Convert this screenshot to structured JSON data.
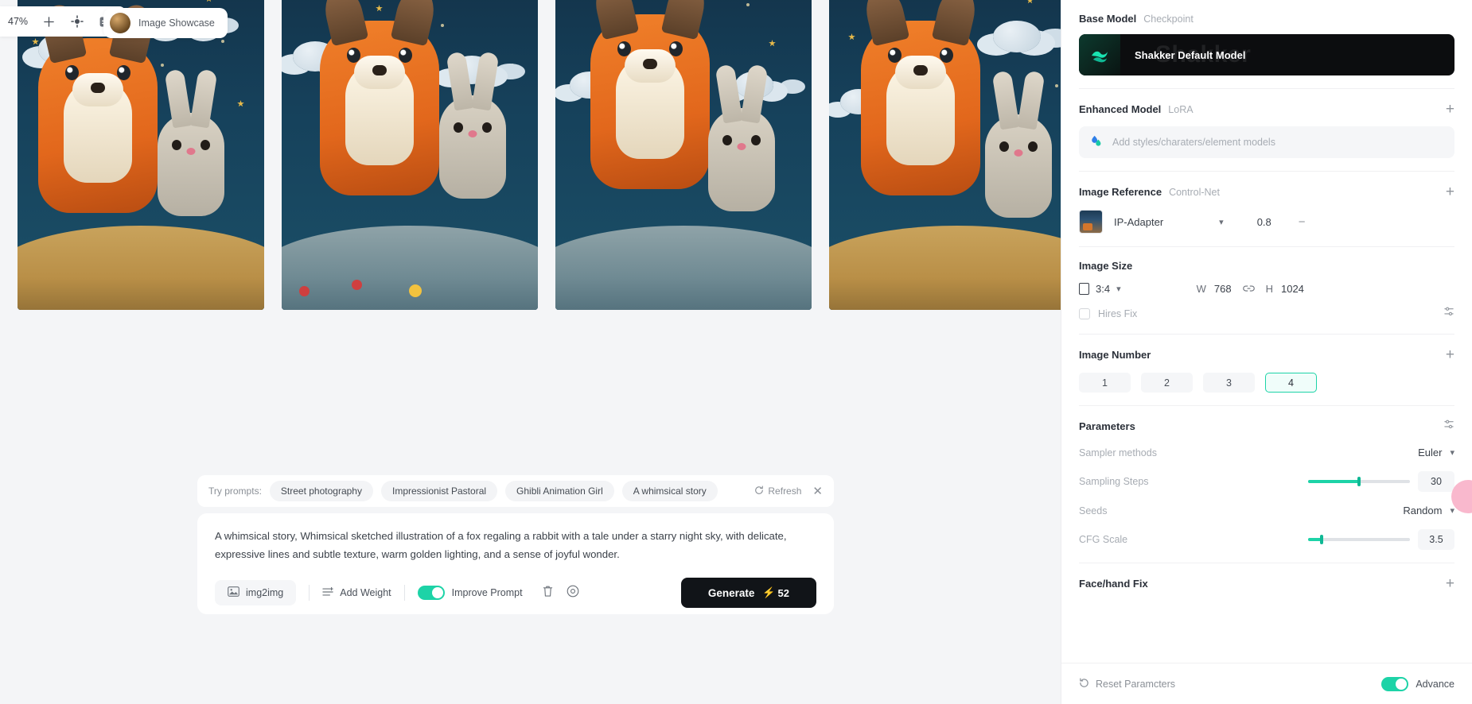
{
  "toolbar": {
    "zoom_level": "47%",
    "add_icon": "plus-icon",
    "target_icon": "focus-target-icon",
    "card_icon": "card-view-icon",
    "showcase_label": "Image Showcase"
  },
  "gallery": {
    "image_alt": "Plush crochet fox and rabbit under a starry night sky",
    "count": 4
  },
  "prompt_panel": {
    "try_label": "Try prompts:",
    "chips": [
      "Street photography",
      "Impressionist Pastoral",
      "Ghibli Animation Girl",
      "A whimsical story"
    ],
    "refresh_label": "Refresh",
    "refresh_icon": "refresh-icon",
    "close_icon": "close-icon",
    "prompt_text": "A whimsical story, Whimsical sketched illustration of a fox regaling a rabbit with a tale under a starry night sky, with delicate, expressive lines and subtle texture, warm golden lighting, and a sense of joyful wonder.",
    "img2img_label": "img2img",
    "img2img_icon": "image-icon",
    "add_weight_label": "Add Weight",
    "add_weight_icon": "weight-icon",
    "improve_prompt_label": "Improve Prompt",
    "improve_prompt_on": true,
    "delete_icon": "trash-icon",
    "settings_icon": "gear-icon",
    "generate_label": "Generate",
    "generate_cost": "52",
    "bolt_icon": "bolt-icon"
  },
  "sidebar": {
    "base_model": {
      "title": "Base Model",
      "subtitle": "Checkpoint",
      "card_name": "Shakker Default Model",
      "watermark": "Shakker"
    },
    "enhanced_model": {
      "title": "Enhanced Model",
      "subtitle": "LoRA",
      "add_icon": "plus-icon",
      "placeholder": "Add styles/charaters/element models",
      "drop_icon": "droplet-icon"
    },
    "image_reference": {
      "title": "Image Reference",
      "subtitle": "Control-Net",
      "add_icon": "plus-icon",
      "type": "IP-Adapter",
      "weight": "0.8",
      "remove_icon": "minus-icon",
      "chevron_icon": "chevron-down-icon"
    },
    "image_size": {
      "title": "Image Size",
      "ratio": "3:4",
      "ratio_icon": "aspect-ratio-icon",
      "chevron_icon": "chevron-down-icon",
      "w_label": "W",
      "w_value": "768",
      "link_icon": "link-icon",
      "h_label": "H",
      "h_value": "1024",
      "hires_label": "Hires Fix",
      "hires_checked": false
    },
    "image_number": {
      "title": "Image Number",
      "options": [
        "1",
        "2",
        "3",
        "4"
      ],
      "selected": "4",
      "add_icon": "plus-icon"
    },
    "parameters": {
      "title": "Parameters",
      "settings_icon": "sliders-icon",
      "sampler_label": "Sampler methods",
      "sampler_value": "Euler",
      "steps_label": "Sampling Steps",
      "steps_value": "30",
      "steps_pct": 50,
      "seeds_label": "Seeds",
      "seeds_value": "Random",
      "cfg_label": "CFG Scale",
      "cfg_value": "3.5",
      "cfg_pct": 13
    },
    "face_hand_fix": {
      "title": "Face/hand Fix",
      "add_icon": "plus-icon"
    },
    "bottom": {
      "reset_label": "Reset Paramcters",
      "reset_icon": "reset-icon",
      "advance_label": "Advance",
      "advance_on": true
    }
  },
  "colors": {
    "accent": "#1dd3a7",
    "generate_bg": "#111418",
    "bolt": "#ffd23f",
    "panel_bg": "#f4f5f7"
  }
}
